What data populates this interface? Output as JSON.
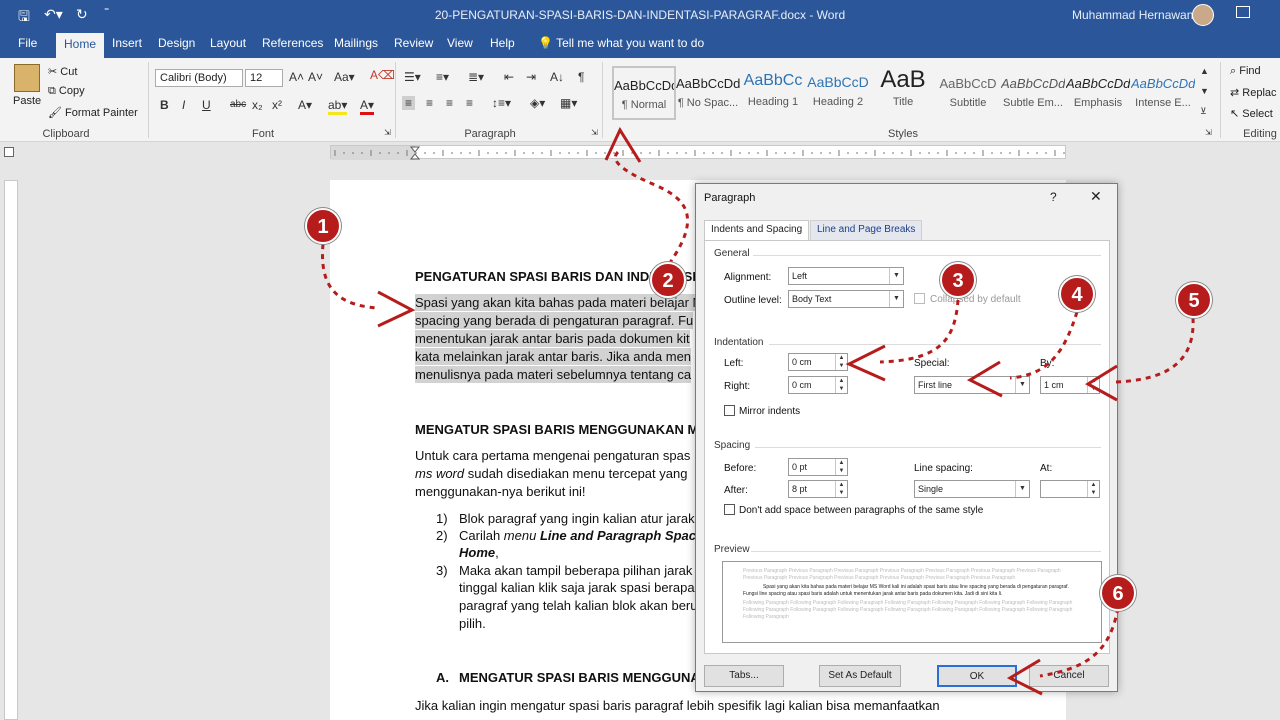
{
  "titlebar": {
    "document_title": "20-PENGATURAN-SPASI-BARIS-DAN-INDENTASI-PARAGRAF.docx  -  Word",
    "user_name": "Muhammad Hernawan",
    "save_icon": "save-icon",
    "undo_icon": "undo-icon",
    "redo_icon": "redo-icon"
  },
  "tabs": [
    "File",
    "Home",
    "Insert",
    "Design",
    "Layout",
    "References",
    "Mailings",
    "Review",
    "View",
    "Help"
  ],
  "tell_me": "Tell me what you want to do",
  "ribbon": {
    "clipboard": {
      "paste": "Paste",
      "cut": "Cut",
      "copy": "Copy",
      "format_painter": "Format Painter",
      "label": "Clipboard"
    },
    "font": {
      "family": "Calibri (Body)",
      "size": "12",
      "label": "Font",
      "bold": "B",
      "italic": "I",
      "underline": "U",
      "strike": "abc"
    },
    "paragraph": {
      "label": "Paragraph"
    },
    "styles": {
      "label": "Styles",
      "items": [
        {
          "preview": "AaBbCcDd",
          "name": "¶ Normal"
        },
        {
          "preview": "AaBbCcDd",
          "name": "¶ No Spac..."
        },
        {
          "preview": "AaBbCc",
          "name": "Heading 1"
        },
        {
          "preview": "AaBbCcD",
          "name": "Heading 2"
        },
        {
          "preview": "AaB",
          "name": "Title"
        },
        {
          "preview": "AaBbCcD",
          "name": "Subtitle"
        },
        {
          "preview": "AaBbCcDd",
          "name": "Subtle Em..."
        },
        {
          "preview": "AaBbCcDd",
          "name": "Emphasis"
        },
        {
          "preview": "AaBbCcDd",
          "name": "Intense E..."
        }
      ]
    },
    "editing": {
      "find": "Find",
      "replace": "Replac",
      "select": "Select",
      "label": "Editing"
    }
  },
  "document": {
    "heading1": "PENGATURAN SPASI BARIS DAN INDENTASI PA",
    "para1": [
      "Spasi yang akan kita bahas pada materi belajar M",
      "spacing yang berada di pengaturan paragraf. Fu",
      "menentukan jarak antar baris pada dokumen kit",
      "kata melainkan jarak antar baris. Jika anda men",
      "menulisnya pada materi sebelumnya tentang ca"
    ],
    "heading2": "MENGATUR SPASI BARIS MENGGUNAKAN MEN",
    "para2_line1": "Untuk cara pertama mengenai pengaturan spas",
    "para2_line2_it": "ms word",
    "para2_line2_rest": " sudah disediakan menu tercepat yang",
    "para2_line3": "menggunakan-nya berikut ini!",
    "list": [
      {
        "num": "1)",
        "text": "Blok paragraf yang ingin kalian atur jarak"
      },
      {
        "num": "2)",
        "text_pre": "Carilah ",
        "text_it": "menu ",
        "text_bold": "Line and Paragraph Spacin",
        "text_line2": "Home",
        "text_line2_after": ","
      },
      {
        "num": "3)",
        "lines": [
          "Maka akan tampil beberapa pilihan jarak",
          "tinggal kalian klik saja jarak spasi berapa",
          "paragraf yang telah kalian blok akan beru",
          "pilih."
        ]
      }
    ],
    "heading3_num": "A.",
    "heading3": "MENGATUR SPASI BARIS MENGGUNAKA",
    "para3": "Jika kalian ingin mengatur spasi baris paragraf lebih spesifik lagi kalian bisa memanfaatkan"
  },
  "dialog": {
    "title": "Paragraph",
    "help": "?",
    "close": "✕",
    "tabs": [
      "Indents and Spacing",
      "Line and Page Breaks"
    ],
    "general": {
      "label": "General",
      "alignment_label": "Alignment:",
      "alignment": "Left",
      "outline_label": "Outline level:",
      "outline": "Body Text",
      "collapsed": "Collapsed by default"
    },
    "indentation": {
      "label": "Indentation",
      "left_label": "Left:",
      "left": "0 cm",
      "right_label": "Right:",
      "right": "0 cm",
      "special_label": "Special:",
      "special": "First line",
      "by_label": "By:",
      "by": "1 cm",
      "mirror": "Mirror indents"
    },
    "spacing": {
      "label": "Spacing",
      "before_label": "Before:",
      "before": "0 pt",
      "after_label": "After:",
      "after": "8 pt",
      "line_label": "Line spacing:",
      "line": "Single",
      "at_label": "At:",
      "at": "",
      "dont_add": "Don't add space between paragraphs of the same style"
    },
    "preview": {
      "label": "Preview",
      "prev": "Previous Paragraph Previous Paragraph Previous Paragraph Previous Paragraph Previous Paragraph Previous Paragraph Previous Paragraph Previous Paragraph Previous Paragraph Previous Paragraph Previous Paragraph Previous Paragraph Previous Paragraph",
      "cur": "Spasi yang akan kita bahas pada materi belajar MS Word kali ini adalah spasi baris atau line spacing yang berada di pengaturan paragraf. Fungsi line spacing atau spasi baris adalah untuk menentukan jarak antar baris pada dokumen kita. Jadi di sini kita li.",
      "next": "Following Paragraph Following Paragraph Following Paragraph Following Paragraph Following Paragraph Following Paragraph Following Paragraph Following Paragraph Following Paragraph Following Paragraph Following Paragraph Following Paragraph Following Paragraph Following Paragraph Following Paragraph"
    },
    "buttons": {
      "tabs": "Tabs...",
      "set_default": "Set As Default",
      "ok": "OK",
      "cancel": "Cancel"
    }
  },
  "annotations": [
    "1",
    "2",
    "3",
    "4",
    "5",
    "6"
  ],
  "colors": {
    "word_blue": "#2b579a",
    "annotation_red": "#b71c1c"
  }
}
